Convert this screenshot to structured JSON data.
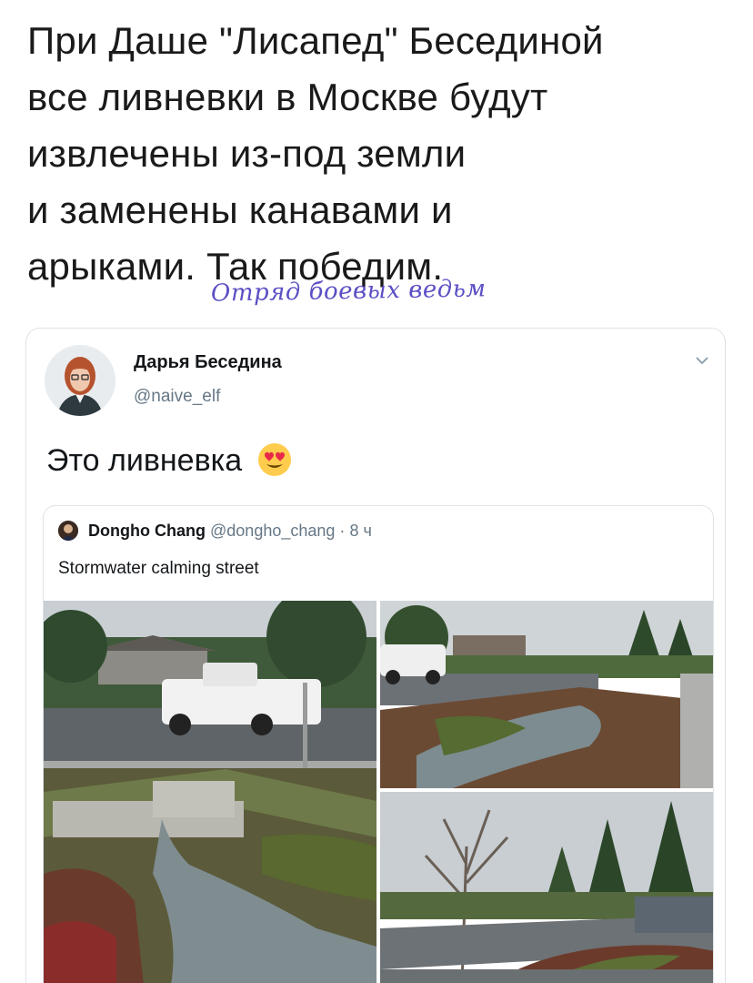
{
  "caption": {
    "lines": [
      "При Даше \"Лисапед\" Бесединой",
      "все ливневки в Москве будут",
      "извлечены из-под земли",
      "и заменены канавами и",
      "арыками. Так победим."
    ]
  },
  "watermark": "Отряд боевых ведьм",
  "tweet": {
    "author_name": "Дарья Беседина",
    "author_handle": "@naive_elf",
    "text": "Это ливневка",
    "emoji": "heart-eyes-emoji"
  },
  "quoted": {
    "author_name": "Dongho Chang",
    "author_handle": "@dongho_chang",
    "separator": "·",
    "time": "8 ч",
    "text": "Stormwater calming street"
  },
  "icons": {
    "menu": "chevron-down-icon"
  },
  "colors": {
    "handle_gray": "#657786",
    "watermark": "#5b4fc4",
    "border": "#dfe3e6"
  }
}
